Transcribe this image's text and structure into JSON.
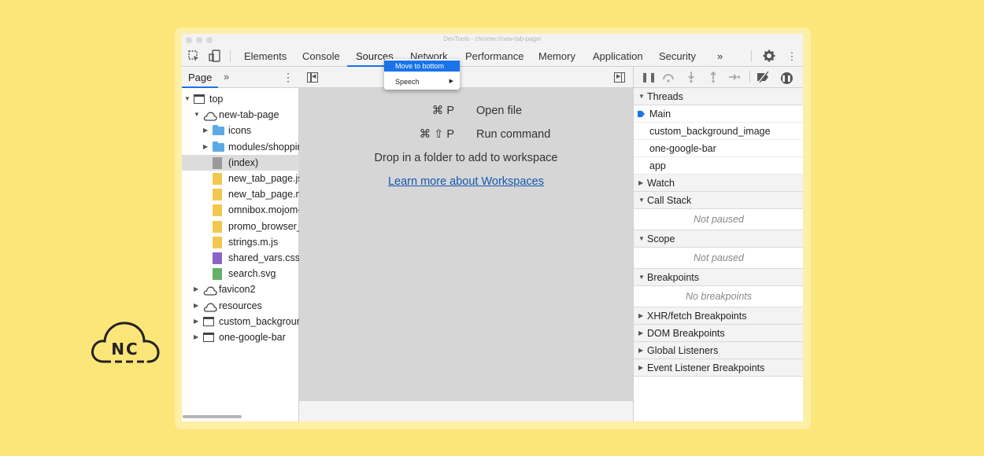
{
  "window": {
    "title": "DevTools - chrome://new-tab-page/"
  },
  "toolbar": {
    "tabs": [
      "Elements",
      "Console",
      "Sources",
      "Network",
      "Performance",
      "Memory",
      "Application",
      "Security"
    ],
    "active_tab": "Sources",
    "more_tabs": "»"
  },
  "context_menu": {
    "items": [
      "Move to bottom",
      "Speech"
    ],
    "highlighted": "Move to bottom"
  },
  "navigator": {
    "tab_label": "Page",
    "more": "»",
    "tree": [
      {
        "label": "top",
        "icon": "frame-icon",
        "expanded": true,
        "depth": 0
      },
      {
        "label": "new-tab-page",
        "icon": "cloud-icon",
        "expanded": true,
        "depth": 1
      },
      {
        "label": "icons",
        "icon": "folder-icon",
        "expanded": false,
        "depth": 2
      },
      {
        "label": "modules/shoppin",
        "icon": "folder-icon",
        "expanded": false,
        "depth": 2
      },
      {
        "label": "(index)",
        "icon": "file-icon",
        "color": "gray",
        "depth": 2,
        "selected": true
      },
      {
        "label": "new_tab_page.js",
        "icon": "file-icon",
        "color": "yellow",
        "depth": 2
      },
      {
        "label": "new_tab_page.m",
        "icon": "file-icon",
        "color": "yellow",
        "depth": 2
      },
      {
        "label": "omnibox.mojom-",
        "icon": "file-icon",
        "color": "yellow",
        "depth": 2
      },
      {
        "label": "promo_browser_",
        "icon": "file-icon",
        "color": "yellow",
        "depth": 2
      },
      {
        "label": "strings.m.js",
        "icon": "file-icon",
        "color": "yellow",
        "depth": 2
      },
      {
        "label": "shared_vars.css",
        "icon": "file-icon",
        "color": "purple",
        "depth": 2
      },
      {
        "label": "search.svg",
        "icon": "file-icon",
        "color": "green",
        "depth": 2
      },
      {
        "label": "favicon2",
        "icon": "cloud-icon",
        "expanded": false,
        "depth": 1
      },
      {
        "label": "resources",
        "icon": "cloud-icon",
        "expanded": false,
        "depth": 1
      },
      {
        "label": "custom_backgrour",
        "icon": "frame-icon",
        "expanded": false,
        "depth": 1
      },
      {
        "label": "one-google-bar",
        "icon": "frame-icon",
        "expanded": false,
        "depth": 1
      }
    ]
  },
  "editor": {
    "shortcuts": [
      {
        "keys": "⌘ P",
        "label": "Open file"
      },
      {
        "keys": "⌘ ⇧ P",
        "label": "Run command"
      }
    ],
    "drop_message": "Drop in a folder to add to workspace",
    "learn_more": "Learn more about Workspaces"
  },
  "debugger": {
    "threads": {
      "title": "Threads",
      "items": [
        "Main",
        "custom_background_image",
        "one-google-bar",
        "app"
      ],
      "current": "Main"
    },
    "watch": "Watch",
    "call_stack": {
      "title": "Call Stack",
      "status": "Not paused"
    },
    "scope": {
      "title": "Scope",
      "status": "Not paused"
    },
    "breakpoints": {
      "title": "Breakpoints",
      "status": "No breakpoints"
    },
    "collapsed_sections": [
      "XHR/fetch Breakpoints",
      "DOM Breakpoints",
      "Global Listeners",
      "Event Listener Breakpoints"
    ]
  },
  "logo": {
    "text": "NC"
  },
  "colors": {
    "background": "#fde679",
    "accent": "#1a73e8",
    "link": "#1557b0"
  }
}
